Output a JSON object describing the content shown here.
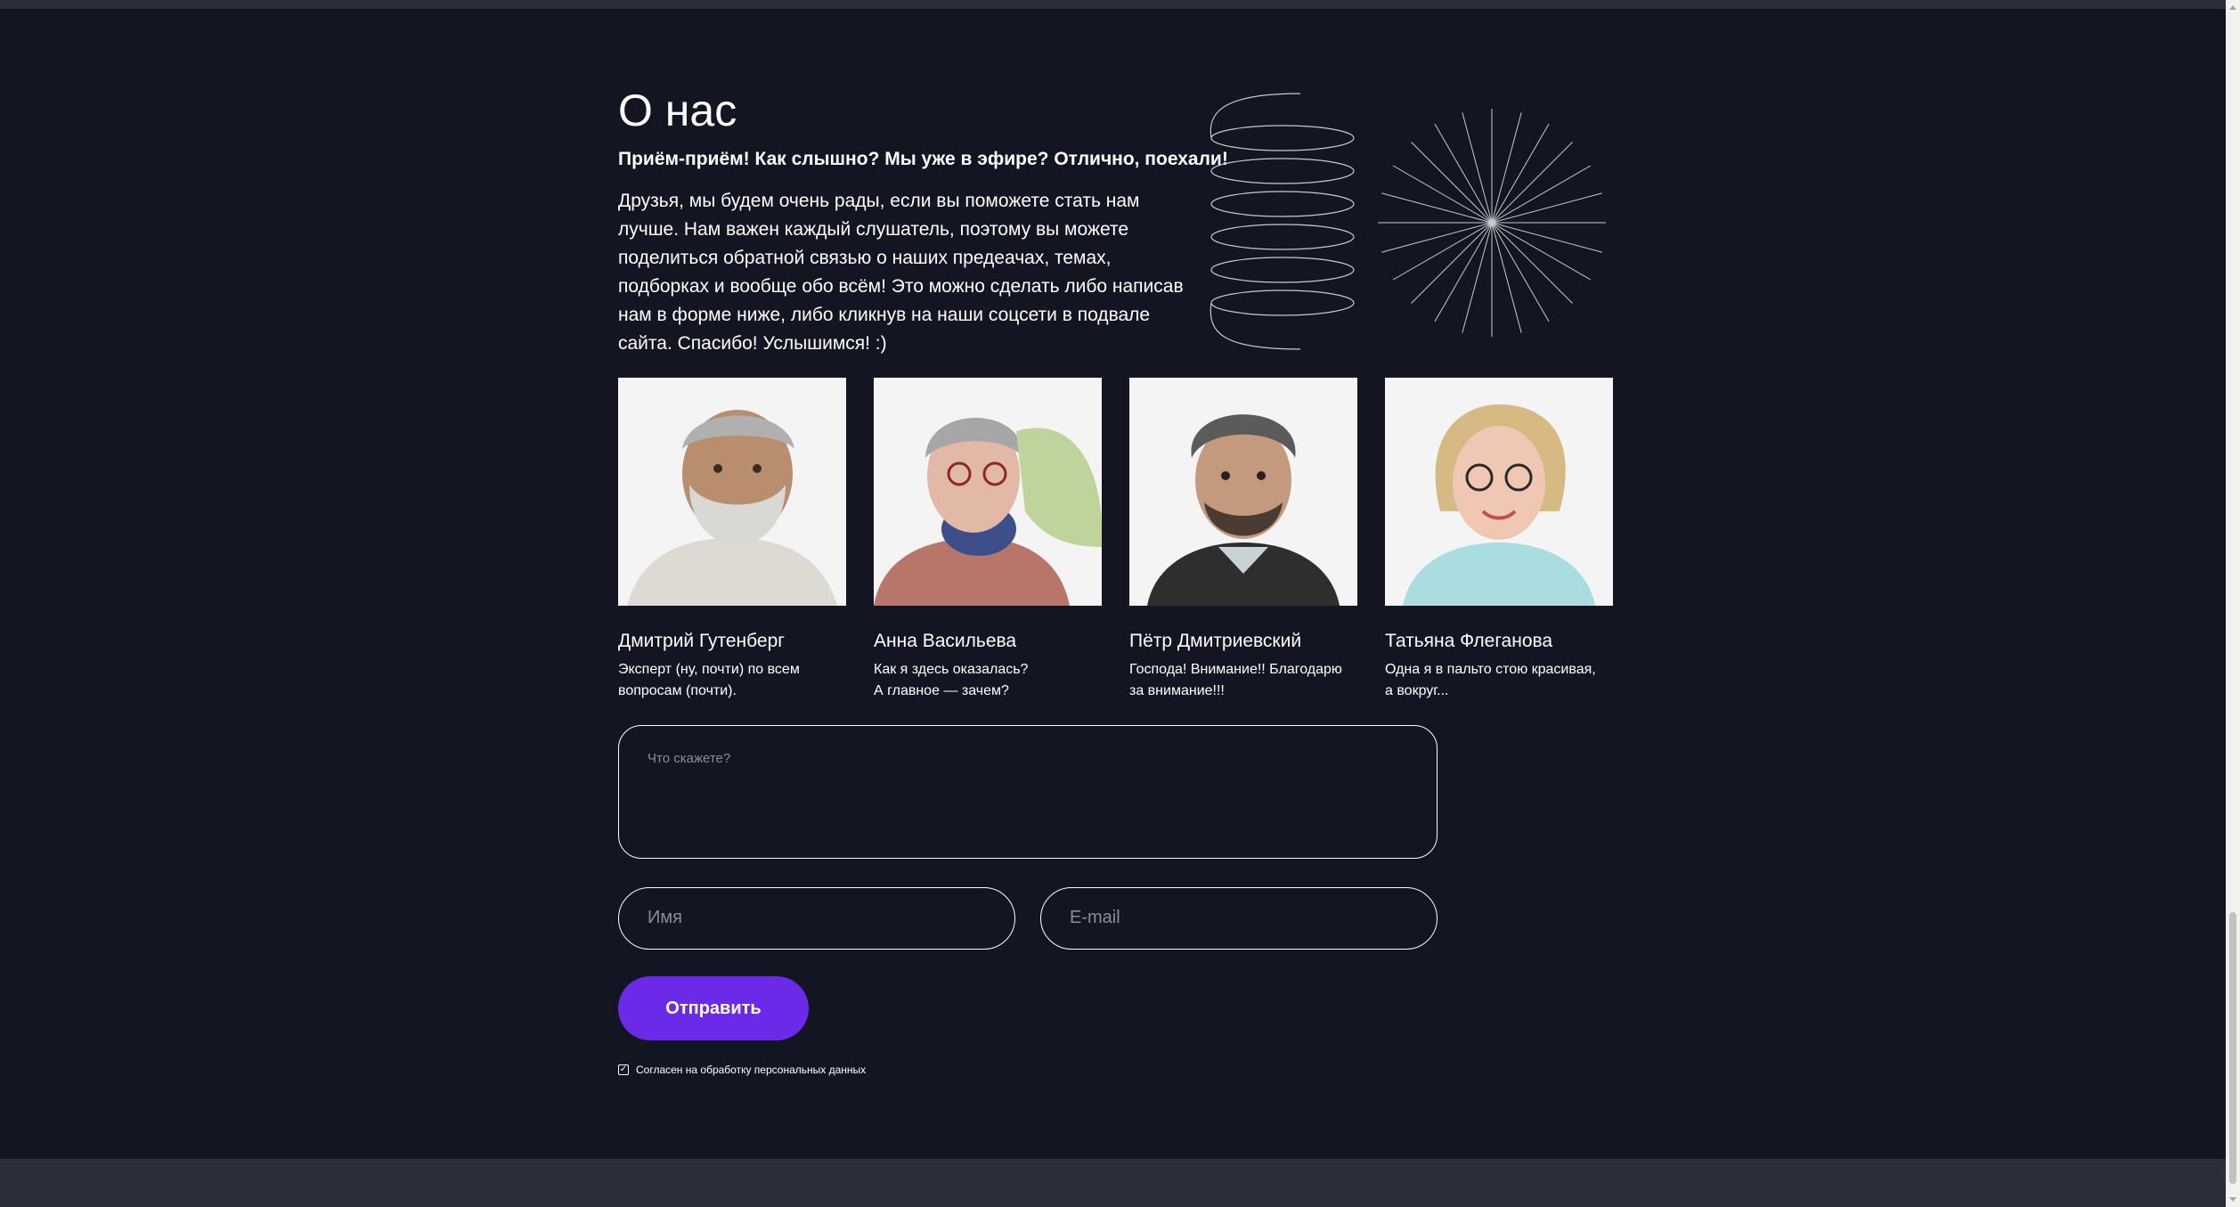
{
  "about": {
    "title": "О нас",
    "subtitle": "Приём-приём! Как слышно? Мы уже в эфире? Отлично, поехали!",
    "intro": "Друзья, мы будем очень рады, если вы поможете стать нам лучше. Нам важен каждый слушатель, поэтому вы можете поделиться обратной связью о наших предеачах, темах, подборках и вообще обо всём! Это можно сделать либо написав нам в форме ниже, либо кликнув на наши соцсети в подвале сайта. Спасибо! Услышимся! :)"
  },
  "team": [
    {
      "name": "Дмитрий Гутенберг",
      "desc_line1": "Эксперт (ну, почти) по всем",
      "desc_line2": "вопросам (почти)."
    },
    {
      "name": "Анна Васильева",
      "desc_line1": "Как я здесь оказалась?",
      "desc_line2": "А главное — зачем?"
    },
    {
      "name": "Пётр Дмитриевский",
      "desc_line1": "Господа! Внимание!! Благодарю",
      "desc_line2": "за внимание!!!"
    },
    {
      "name": "Татьяна Флеганова",
      "desc_line1": "Одна я в пальто стою красивая,",
      "desc_line2": "а вокруг..."
    }
  ],
  "form": {
    "message_placeholder": "Что скажете?",
    "name_placeholder": "Имя",
    "email_placeholder": "E-mail",
    "submit_label": "Отправить",
    "consent_label": "Согласен на обработку персональных данных",
    "consent_checked": true
  },
  "colors": {
    "background": "#141522",
    "footer": "#2b2d38",
    "accent": "#6b2ae8",
    "text": "#ffffff"
  }
}
